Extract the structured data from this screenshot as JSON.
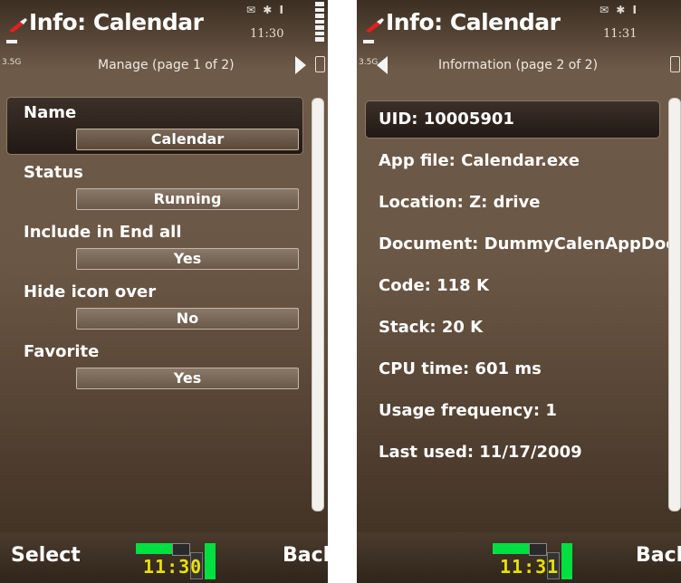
{
  "screen1": {
    "title": "Info: Calendar",
    "time": "11:30",
    "net": "3.5G",
    "subtitle": "Manage (page 1 of 2)",
    "fields": [
      {
        "label": "Name",
        "value": "Calendar"
      },
      {
        "label": "Status",
        "value": "Running"
      },
      {
        "label": "Include in End all",
        "value": "Yes"
      },
      {
        "label": "Hide icon over",
        "value": "No"
      },
      {
        "label": "Favorite",
        "value": "Yes"
      }
    ],
    "softkey_left": "Select",
    "softkey_right": "Back",
    "clock_digits": "11:30"
  },
  "screen2": {
    "title": "Info: Calendar",
    "time": "11:31",
    "net": "3.5G",
    "subtitle": "Information (page 2 of 2)",
    "rows": [
      "UID: 10005901",
      "App file: Calendar.exe",
      "Location: Z: drive",
      "Document: DummyCalenAppDoc",
      "Code: 118 K",
      "Stack: 20 K",
      "CPU time: 601 ms",
      "Usage frequency: 1",
      "Last used: 11/17/2009"
    ],
    "softkey_right": "Back",
    "clock_digits": "11:31"
  },
  "colors": {
    "background": "#6b5745",
    "selection": "#221914",
    "clock_green": "#00e040",
    "clock_yellow": "#e8e000"
  },
  "icons": [
    "calendar-app-icon",
    "email-icon",
    "bluetooth-icon",
    "signal-icon",
    "battery-icon",
    "right-arrow-icon",
    "left-arrow-icon"
  ]
}
